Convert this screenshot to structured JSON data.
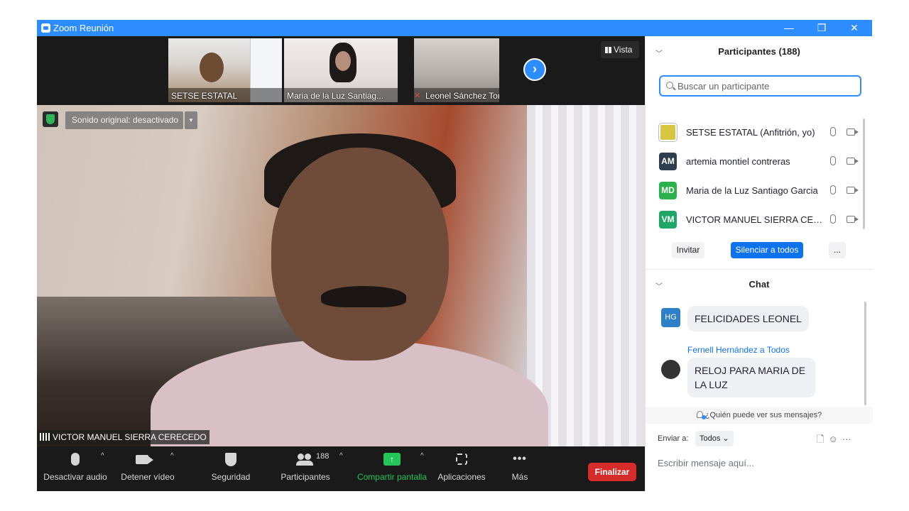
{
  "window": {
    "title": "Zoom Reunión",
    "minimize": "—",
    "restore": "❐",
    "close": "✕"
  },
  "thumbnails": [
    {
      "name": "SETSE ESTATAL"
    },
    {
      "name": "Maria de la Luz Santiag..."
    },
    {
      "name": "Leonel Sánchez Torres"
    }
  ],
  "view_button": "Vista",
  "next_arrow": "›",
  "main_video": {
    "sound_button": "Sonido original: desactivado",
    "speaker_name": "VICTOR MANUEL SIERRA CERECEDO"
  },
  "toolbar": {
    "mute": "Desactivar audio",
    "stop_video": "Detener vídeo",
    "security": "Seguridad",
    "participants": "Participantes",
    "participants_count": "188",
    "share": "Compartir pantalla",
    "apps": "Aplicaciones",
    "more": "Más",
    "end": "Finalizar",
    "caret": "^"
  },
  "participants_panel": {
    "title": "Participantes (188)",
    "search_placeholder": "Buscar un participante",
    "items": [
      {
        "initials": "",
        "name": "SETSE ESTATAL (Anfitrión, yo)",
        "color": "#d7c640"
      },
      {
        "initials": "AM",
        "name": "artemia montiel contreras",
        "color": "#2f3e4e"
      },
      {
        "initials": "MD",
        "name": "Maria de la Luz Santiago Garcia",
        "color": "#2bb24c"
      },
      {
        "initials": "VM",
        "name": "VICTOR MANUEL SIERRA CEREC...",
        "color": "#1ea667"
      }
    ],
    "invite": "Invitar",
    "mute_all": "Silenciar a todos",
    "more": "..."
  },
  "chat": {
    "title": "Chat",
    "messages": [
      {
        "initials": "HG",
        "text": "FELICIDADES LEONEL",
        "avatar_color": "#2d7fc8"
      },
      {
        "sender": "Fernell Hernández a Todos",
        "text": "RELOJ PARA  MARIA DE LA LUZ",
        "avatar_color": "#333333"
      }
    ],
    "who_sees": "¿Quién puede ver sus mensajes?",
    "send_to_label": "Enviar a:",
    "recipient": "Todos",
    "message_placeholder": "Escribir mensaje aquí..."
  },
  "colors": {
    "accent": "#2d8cff",
    "end_button": "#d62b2b",
    "share_button": "#25c55a"
  },
  "icons": [
    "zoom-app-icon",
    "minimize-icon",
    "restore-icon",
    "close-icon",
    "grid-icon",
    "chevron-right-icon",
    "shield-icon",
    "microphone-icon",
    "camera-icon",
    "participants-icon",
    "share-screen-icon",
    "apps-icon",
    "more-icon",
    "search-icon",
    "file-icon",
    "emoji-icon",
    "person-icon"
  ]
}
